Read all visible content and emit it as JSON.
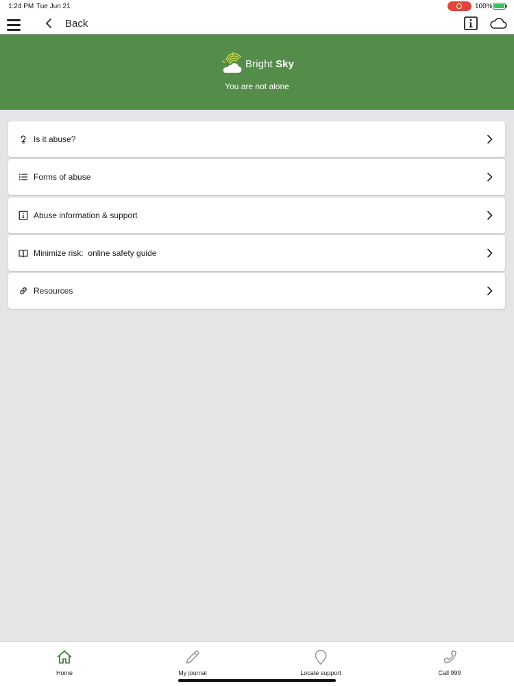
{
  "status_bar": {
    "time": "1:24 PM",
    "date": "Tue Jun 21",
    "battery": "100%"
  },
  "nav": {
    "back_label": "Back"
  },
  "banner": {
    "brand_regular": "Bright ",
    "brand_bold": "Sky",
    "tagline": "You are not alone"
  },
  "menu": [
    {
      "label": "Is it abuse?",
      "icon": "question-bulb-icon"
    },
    {
      "label": "Forms of abuse",
      "icon": "list-icon"
    },
    {
      "label": "Abuse information & support",
      "icon": "info-square-icon"
    },
    {
      "label": "Minimize risk:  online safety guide",
      "icon": "book-icon"
    },
    {
      "label": "Resources",
      "icon": "link-icon"
    }
  ],
  "tabs": [
    {
      "label": "Home",
      "icon": "home-icon"
    },
    {
      "label": "My journal",
      "icon": "pencil-icon"
    },
    {
      "label": "Locate support",
      "icon": "location-pin-icon"
    },
    {
      "label": "Call 999",
      "icon": "phone-icon"
    }
  ],
  "colors": {
    "banner_green": "#548c49",
    "background": "#e5e5e8",
    "home_tab_active": "#3f7a36",
    "inactive_icon": "#999999"
  }
}
